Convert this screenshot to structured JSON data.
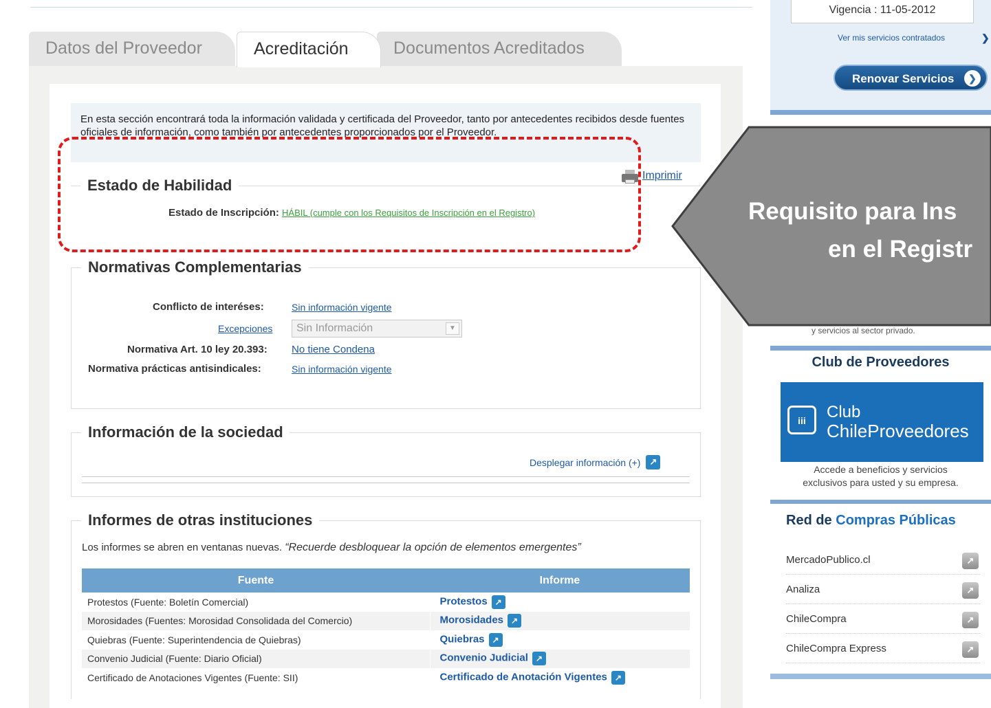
{
  "tabs": [
    "Datos del Proveedor",
    "Acreditación",
    "Documentos Acreditados"
  ],
  "intro": "En esta sección encontrará toda la información validada y certificada del Proveedor, tanto por antecedentes recibidos desde fuentes oficiales de información, como también por antecedentes proporcionados por el Proveedor.",
  "print_label": "Imprimir",
  "habilidad": {
    "title": "Estado de Habilidad",
    "label": "Estado de Inscripción:",
    "value": "HÁBIL (cumple con los Requisitos de Inscripción en el Registro)"
  },
  "normativas": {
    "title": "Normativas Complementarias",
    "conflicto_label": "Conflicto de interéses:",
    "conflicto_value": "Sin información vigente",
    "excepciones_label": "Excepciones",
    "excepciones_select": "Sin Información",
    "art10_label": "Normativa Art. 10 ley 20.393:",
    "art10_value": "No tiene Condena",
    "antisindicales_label": "Normativa prácticas antisindicales:",
    "antisindicales_value": "Sin información vigente"
  },
  "sociedad": {
    "title": "Información de la sociedad",
    "expand": "Desplegar información (+)"
  },
  "informes": {
    "title": "Informes de otras instituciones",
    "notice": "Los informes se abren en ventanas nuevas.",
    "notice_italic": "“Recuerde desbloquear la opción de elementos emergentes”",
    "col_fuente": "Fuente",
    "col_informe": "Informe",
    "rows": [
      {
        "fuente": "Protestos (Fuente: Boletín Comercial)",
        "informe": "Protestos"
      },
      {
        "fuente": "Morosidades (Fuentes: Morosidad Consolidada del Comercio)",
        "informe": "Morosidades"
      },
      {
        "fuente": "Quiebras (Fuente: Superintendencia de Quiebras)",
        "informe": "Quiebras"
      },
      {
        "fuente": "Convenio Judicial (Fuente: Diario Oficial)",
        "informe": "Convenio Judicial"
      },
      {
        "fuente": "Certificado de Anotaciones Vigentes (Fuente: SII)",
        "informe": "Certificado de Anotación Vigentes"
      }
    ]
  },
  "sidebar": {
    "vigencia": "Vigencia : 11-05-2012",
    "ver_servicios": "Ver mis servicios contratados",
    "renovar": "Renovar Servicios",
    "faded_text": "y servicios al sector privado.",
    "callout_line1": "Requisito para Ins",
    "callout_line2": "en el Registr",
    "club_title": "Club de Proveedores",
    "club_logo_1": "Club",
    "club_logo_2": "ChileProveedores",
    "club_desc_1": "Accede a beneficios y servicios",
    "club_desc_2": "exclusivos para usted y su empresa.",
    "red_title_a": "Red de",
    "red_title_b": "Compras Públicas",
    "red_items": [
      "MercadoPublico.cl",
      "Analiza",
      "ChileCompra",
      "ChileCompra Express"
    ]
  },
  "colors": {
    "accent_blue": "#1d5aa6",
    "table_header": "#6da2cf",
    "dashed_highlight": "#e01b1b",
    "callout_gray": "#8a8a8a",
    "habil_green": "#3aa03a"
  }
}
